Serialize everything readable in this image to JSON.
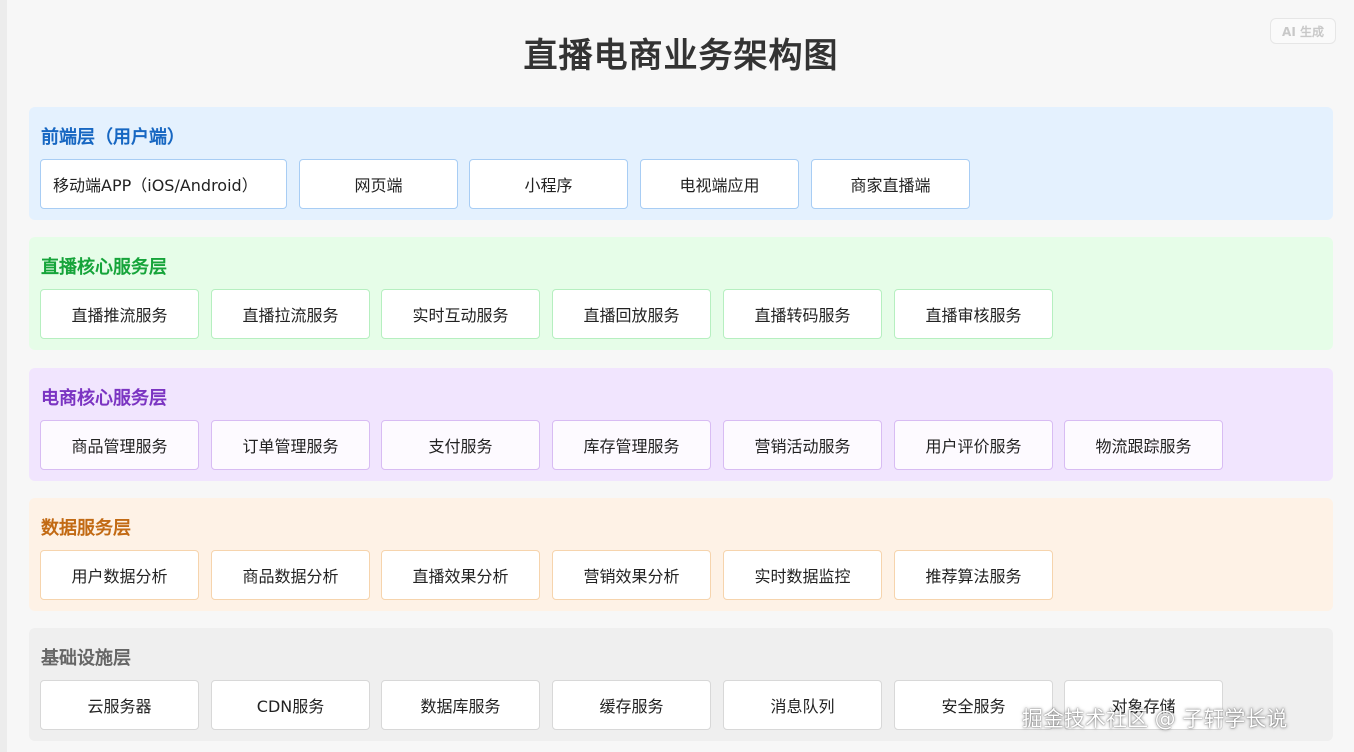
{
  "title": "直播电商业务架构图",
  "ai_badge": "AI 生成",
  "layers": [
    {
      "title": "前端层（用户端）",
      "color": "#1767c2",
      "items": [
        "移动端APP（iOS/Android）",
        "网页端",
        "小程序",
        "电视端应用",
        "商家直播端"
      ]
    },
    {
      "title": "直播核心服务层",
      "color": "#16a43a",
      "items": [
        "直播推流服务",
        "直播拉流服务",
        "实时互动服务",
        "直播回放服务",
        "直播转码服务",
        "直播审核服务"
      ]
    },
    {
      "title": "电商核心服务层",
      "color": "#7b34c2",
      "items": [
        "商品管理服务",
        "订单管理服务",
        "支付服务",
        "库存管理服务",
        "营销活动服务",
        "用户评价服务",
        "物流跟踪服务"
      ]
    },
    {
      "title": "数据服务层",
      "color": "#c26a14",
      "items": [
        "用户数据分析",
        "商品数据分析",
        "直播效果分析",
        "营销效果分析",
        "实时数据监控",
        "推荐算法服务"
      ]
    },
    {
      "title": "基础设施层",
      "color": "#666666",
      "items": [
        "云服务器",
        "CDN服务",
        "数据库服务",
        "缓存服务",
        "消息队列",
        "安全服务",
        "对象存储"
      ]
    }
  ],
  "watermark": "掘金技术社区 @ 子轩学长说"
}
